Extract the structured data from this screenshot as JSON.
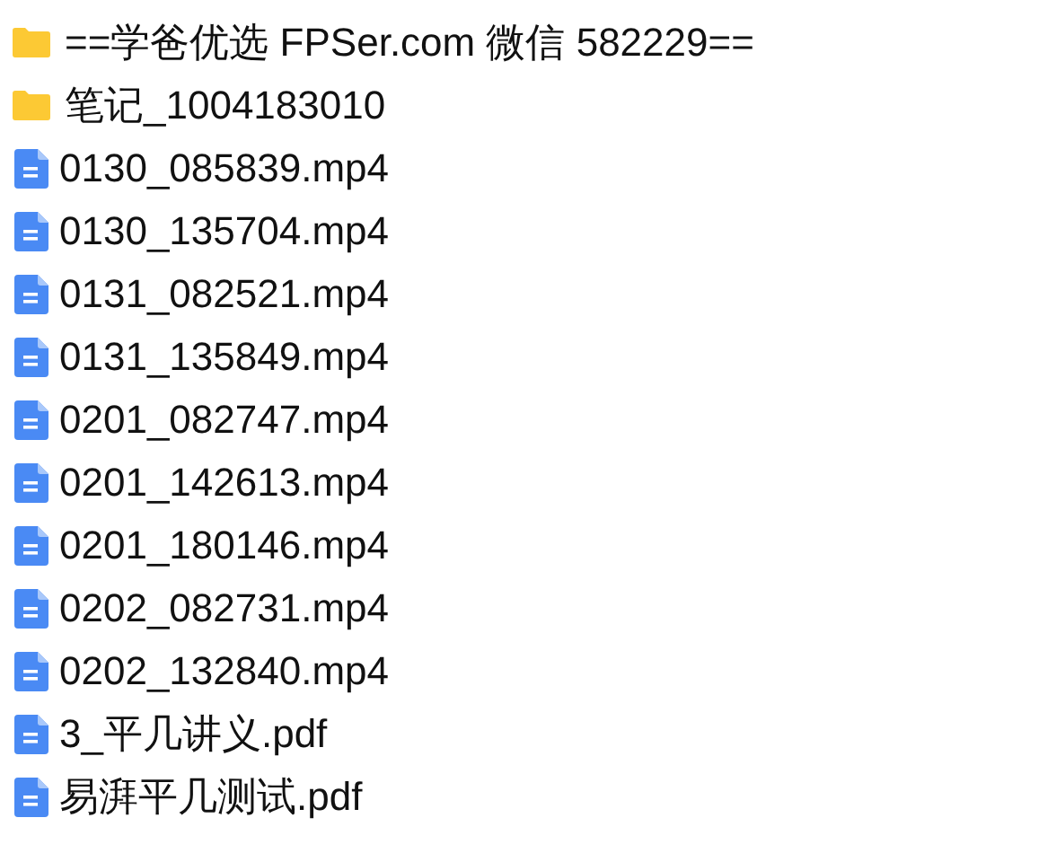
{
  "files": [
    {
      "kind": "folder",
      "name": "==学爸优选 FPSer.com 微信 582229=="
    },
    {
      "kind": "folder",
      "name": "笔记_1004183010"
    },
    {
      "kind": "file",
      "name": "0130_085839.mp4"
    },
    {
      "kind": "file",
      "name": "0130_135704.mp4"
    },
    {
      "kind": "file",
      "name": "0131_082521.mp4"
    },
    {
      "kind": "file",
      "name": "0131_135849.mp4"
    },
    {
      "kind": "file",
      "name": "0201_082747.mp4"
    },
    {
      "kind": "file",
      "name": "0201_142613.mp4"
    },
    {
      "kind": "file",
      "name": "0201_180146.mp4"
    },
    {
      "kind": "file",
      "name": "0202_082731.mp4"
    },
    {
      "kind": "file",
      "name": "0202_132840.mp4"
    },
    {
      "kind": "file",
      "name": "3_平几讲义.pdf"
    },
    {
      "kind": "file",
      "name": "易湃平几测试.pdf"
    }
  ]
}
